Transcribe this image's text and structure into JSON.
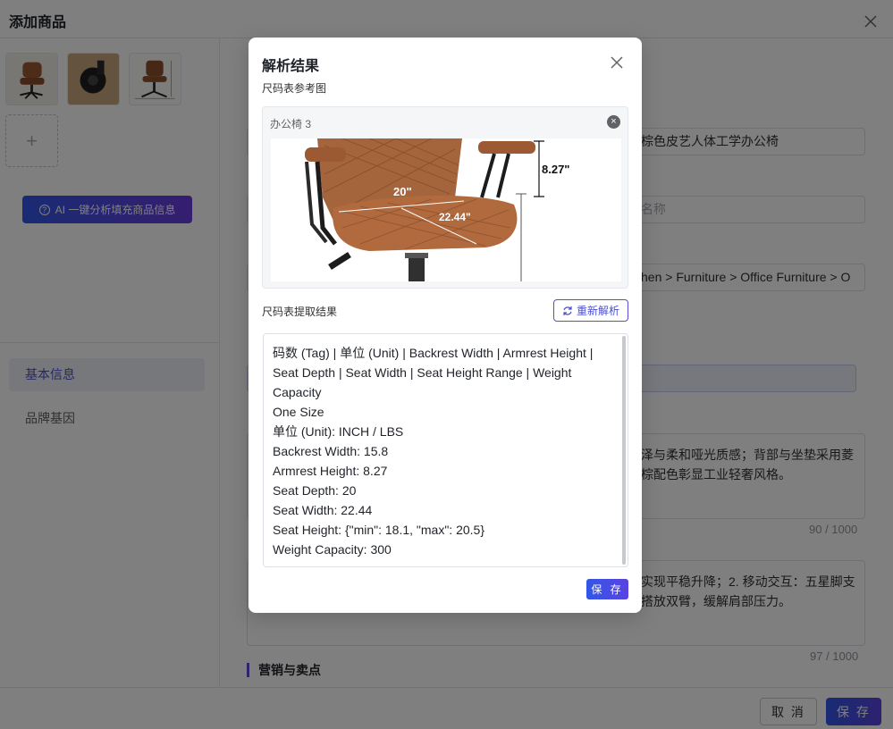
{
  "page": {
    "title": "添加商品"
  },
  "left": {
    "ai_button_label": "AI 一键分析填充商品信息",
    "upload_plus": "+",
    "nav": [
      {
        "label": "基本信息",
        "active": true
      },
      {
        "label": "品牌基因",
        "active": false
      }
    ]
  },
  "form": {
    "title_value": "棕色皮艺人体工学办公椅",
    "name_placeholder": "名称",
    "category_value": "hen > Furniture > Office Furniture > O",
    "desc1_line1": "泽与柔和哑光质感；背部与坐垫采用菱",
    "desc1_line2": "棕配色彰显工业轻奢风格。",
    "desc1_count": "90 / 1000",
    "desc2_line1": "实现平稳升降；2. 移动交互：五星脚支",
    "desc2_line2": "搭放双臂，缓解肩部压力。",
    "desc2_count": "97 / 1000",
    "marketing_heading": "营销与卖点"
  },
  "footer": {
    "cancel_label": "取 消",
    "save_label": "保 存"
  },
  "modal": {
    "title": "解析结果",
    "ref_label": "尺码表参考图",
    "ref_card_title": "办公椅 3",
    "ref_remove_glyph": "×",
    "image_annotations": {
      "armrest_height": "8.27\"",
      "backrest_width": "20\"",
      "seat_width": "22.44\""
    },
    "extract_label": "尺码表提取结果",
    "reparse_label": "重新解析",
    "result_lines": [
      "码数 (Tag) | 单位 (Unit) | Backrest Width | Armrest Height |",
      "Seat Depth | Seat Width | Seat Height Range | Weight",
      "Capacity",
      "One Size",
      "单位 (Unit): INCH / LBS",
      "Backrest Width: 15.8",
      "Armrest Height: 8.27",
      "Seat Depth: 20",
      "Seat Width: 22.44",
      "Seat Height: {\"min\": 18.1, \"max\": 20.5}",
      "Weight Capacity: 300"
    ],
    "save_label": "保 存"
  },
  "colors": {
    "accent": "#5b4bdb",
    "primary_gradient_start": "#3257e8",
    "primary_gradient_end": "#5a43df",
    "overlay": "rgba(0,0,0,0.5)"
  }
}
